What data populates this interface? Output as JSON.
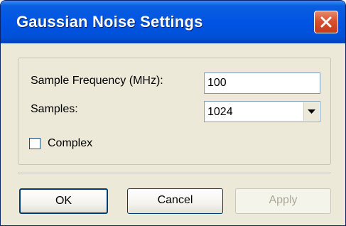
{
  "window": {
    "title": "Gaussian Noise Settings",
    "close_icon": "close-icon"
  },
  "form": {
    "sample_frequency_label": "Sample Frequency (MHz):",
    "sample_frequency_value": "100",
    "samples_label": "Samples:",
    "samples_selected": "1024",
    "complex_label": "Complex",
    "complex_checked": false
  },
  "buttons": {
    "ok_label": "OK",
    "cancel_label": "Cancel",
    "apply_label": "Apply"
  },
  "colors": {
    "titlebar": "#0054e3",
    "close_button": "#d8512f",
    "dialog_background": "#ece9d8"
  }
}
